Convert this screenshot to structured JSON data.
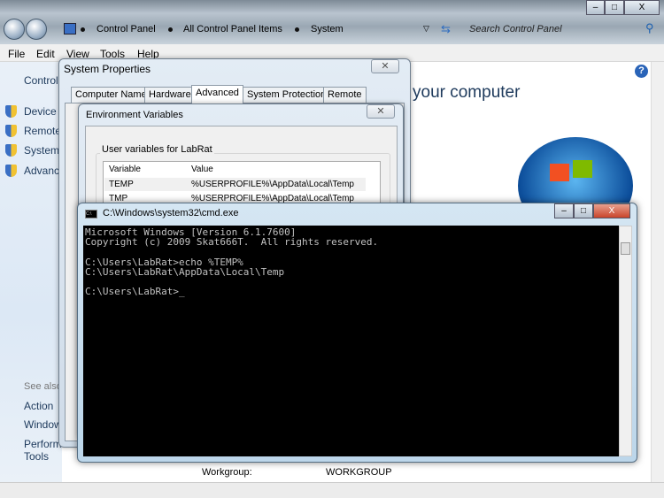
{
  "explorer": {
    "breadcrumb": [
      "Control Panel",
      "All Control Panel Items",
      "System"
    ],
    "search_placeholder": "Search Control Panel",
    "window_buttons": {
      "minimize": "–",
      "maximize": "□",
      "close": "X"
    },
    "menu": [
      "File",
      "Edit",
      "View",
      "Tools",
      "Help"
    ],
    "left_pane": {
      "home": "Control",
      "tasks": [
        "Device",
        "Remote",
        "System",
        "Advanc"
      ],
      "see_also": "See also",
      "links": [
        "Action",
        "Window",
        "Perform",
        "Tools"
      ]
    },
    "heading": "your computer",
    "workgroup_label": "Workgroup:",
    "workgroup_value": "WORKGROUP"
  },
  "system_properties": {
    "title": "System Properties",
    "tabs": [
      "Computer Name",
      "Hardware",
      "Advanced",
      "System Protection",
      "Remote"
    ],
    "active_tab": "Advanced"
  },
  "env_vars": {
    "title": "Environment Variables",
    "group_label": "User variables for LabRat",
    "columns": [
      "Variable",
      "Value"
    ],
    "rows": [
      {
        "variable": "TEMP",
        "value": "%USERPROFILE%\\AppData\\Local\\Temp"
      },
      {
        "variable": "TMP",
        "value": "%USERPROFILE%\\AppData\\Local\\Temp"
      }
    ]
  },
  "cmd": {
    "title": "C:\\Windows\\system32\\cmd.exe",
    "output": "Microsoft Windows [Version 6.1.7600]\nCopyright (c) 2009 Skat666T.  All rights reserved.\n\nC:\\Users\\LabRat>echo %TEMP%\nC:\\Users\\LabRat\\AppData\\Local\\Temp\n\nC:\\Users\\LabRat>_"
  }
}
